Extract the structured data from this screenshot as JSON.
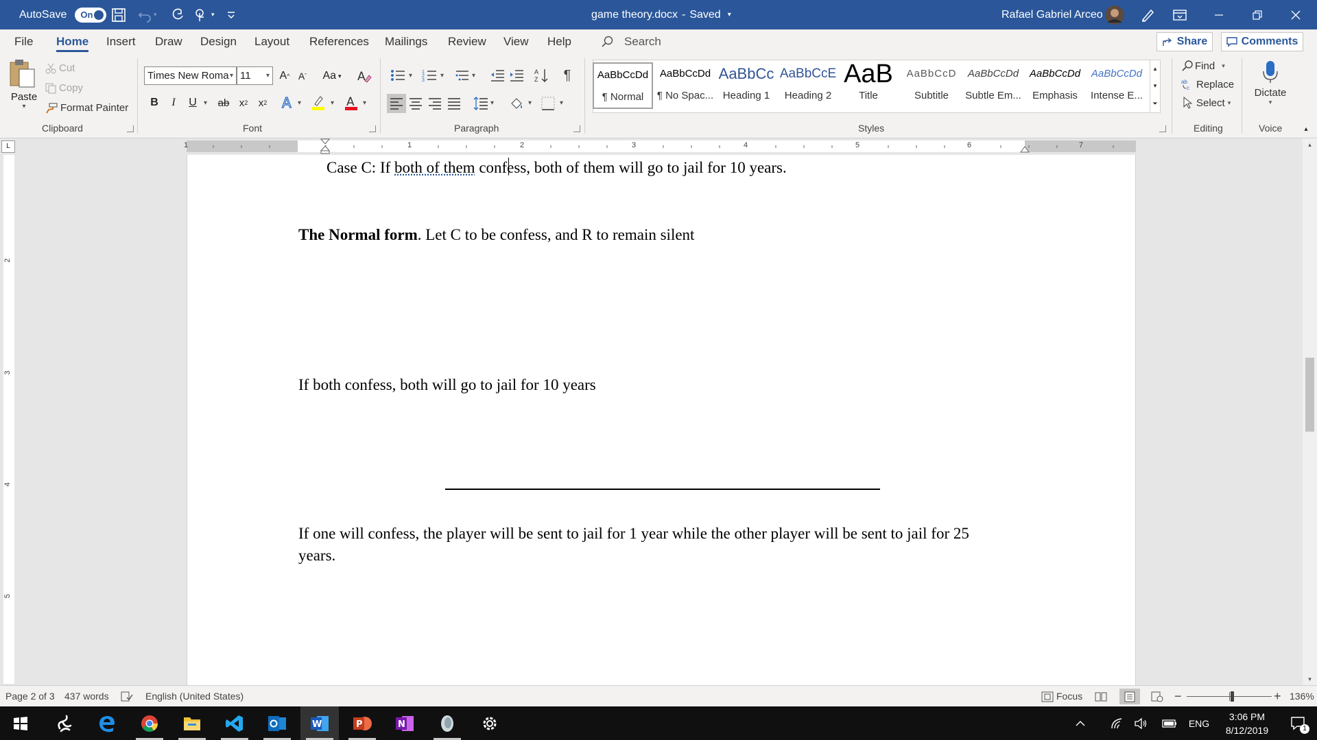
{
  "titlebar": {
    "autosave_label": "AutoSave",
    "autosave_state": "On",
    "doc_title": "game theory.docx",
    "separator": "-",
    "save_state": "Saved",
    "user_name": "Rafael Gabriel Arceo"
  },
  "menu": {
    "tabs": [
      "File",
      "Home",
      "Insert",
      "Draw",
      "Design",
      "Layout",
      "References",
      "Mailings",
      "Review",
      "View",
      "Help"
    ],
    "search_label": "Search",
    "share_label": "Share",
    "comments_label": "Comments"
  },
  "clipboard": {
    "paste": "Paste",
    "cut": "Cut",
    "copy": "Copy",
    "format_painter": "Format Painter",
    "label": "Clipboard"
  },
  "font": {
    "name": "Times New Roma",
    "size": "11",
    "case_label": "Aa",
    "label": "Font"
  },
  "paragraph": {
    "label": "Paragraph"
  },
  "styles": {
    "label": "Styles",
    "items": [
      {
        "preview": "AaBbCcDd",
        "name": "¶ Normal"
      },
      {
        "preview": "AaBbCcDd",
        "name": "¶ No Spac..."
      },
      {
        "preview": "AaBbCc",
        "name": "Heading 1"
      },
      {
        "preview": "AaBbCcE",
        "name": "Heading 2"
      },
      {
        "preview": "AaB",
        "name": "Title"
      },
      {
        "preview": "AaBbCcD",
        "name": "Subtitle"
      },
      {
        "preview": "AaBbCcDd",
        "name": "Subtle Em..."
      },
      {
        "preview": "AaBbCcDd",
        "name": "Emphasis"
      },
      {
        "preview": "AaBbCcDd",
        "name": "Intense E..."
      }
    ]
  },
  "editing": {
    "find": "Find",
    "replace": "Replace",
    "select": "Select",
    "label": "Editing"
  },
  "voice": {
    "dictate": "Dictate",
    "label": "Voice"
  },
  "ruler": {
    "numbers": [
      "1",
      "1",
      "2",
      "3",
      "4",
      "5",
      "6",
      "7"
    ],
    "v_numbers": [
      "2",
      "3",
      "4",
      "5"
    ]
  },
  "document": {
    "case_c_prefix": "Case C: If ",
    "case_c_underlined": "both of them",
    "case_c_rest": " confess, both of them will go to jail for 10 years.",
    "normal_form_bold": "The Normal form",
    "normal_form_rest": ". Let C to be confess, and R to remain silent",
    "both_confess": "If both confess, both will go to jail for 10 years",
    "one_confess_line1": "If one will confess, the player will be sent to jail for 1 year while the other player will be sent to jail for 25",
    "one_confess_line2": "years."
  },
  "status": {
    "page": "Page 2 of 3",
    "words": "437 words",
    "language": "English (United States)",
    "focus": "Focus",
    "zoom": "136%"
  },
  "taskbar": {
    "language": "ENG",
    "time": "3:06 PM",
    "date": "8/12/2019",
    "notifications": "1"
  },
  "colors": {
    "word_blue": "#2b579a",
    "page": "#ffffff",
    "workspace": "#e6e6e6"
  }
}
